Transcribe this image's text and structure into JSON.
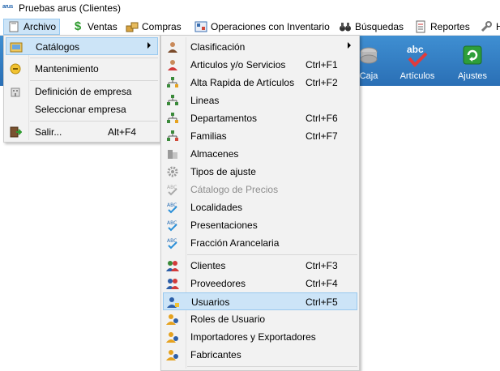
{
  "window": {
    "title": "Pruebas arus (Clientes)",
    "app_icon_text": "arus"
  },
  "menubar": {
    "items": [
      {
        "label": "Archivo",
        "icon": "file-icon"
      },
      {
        "label": "Ventas",
        "icon": "dollar-icon"
      },
      {
        "label": "Compras",
        "icon": "boxes-icon"
      },
      {
        "label": "Operaciones con Inventario",
        "icon": "inventory-icon"
      },
      {
        "label": "Búsquedas",
        "icon": "binoculars-icon"
      },
      {
        "label": "Reportes",
        "icon": "report-icon"
      },
      {
        "label": "H",
        "icon": "wrench-icon"
      }
    ]
  },
  "toolbar": {
    "caja": "Caja",
    "articulos": "Artículos",
    "articulos_badge": "abc",
    "ajustes": "Ajustes"
  },
  "archivo_menu": {
    "items": [
      {
        "label": "Catálogos",
        "shortcut": "",
        "submenu": true
      },
      {
        "label": "Mantenimiento",
        "shortcut": ""
      },
      {
        "label": "Definición de empresa",
        "shortcut": ""
      },
      {
        "label": "Seleccionar empresa",
        "shortcut": ""
      },
      {
        "label": "Salir...",
        "shortcut": "Alt+F4"
      }
    ]
  },
  "catalogos_menu": {
    "items": [
      {
        "label": "Clasificación",
        "shortcut": "",
        "submenu": true
      },
      {
        "label": "Articulos y/o Servicios",
        "shortcut": "Ctrl+F1"
      },
      {
        "label": "Alta Rapida de Artículos",
        "shortcut": "Ctrl+F2"
      },
      {
        "label": "Lineas",
        "shortcut": ""
      },
      {
        "label": "Departamentos",
        "shortcut": "Ctrl+F6"
      },
      {
        "label": "Familias",
        "shortcut": "Ctrl+F7"
      },
      {
        "label": "Almacenes",
        "shortcut": ""
      },
      {
        "label": "Tipos de ajuste",
        "shortcut": ""
      },
      {
        "label": "Cátalogo de Precios",
        "shortcut": "",
        "disabled": true
      },
      {
        "label": "Localidades",
        "shortcut": ""
      },
      {
        "label": "Presentaciones",
        "shortcut": ""
      },
      {
        "label": "Fracción Arancelaria",
        "shortcut": ""
      },
      {
        "label": "Clientes",
        "shortcut": "Ctrl+F3"
      },
      {
        "label": "Proveedores",
        "shortcut": "Ctrl+F4"
      },
      {
        "label": "Usuarios",
        "shortcut": "Ctrl+F5"
      },
      {
        "label": "Roles de Usuario",
        "shortcut": ""
      },
      {
        "label": "Importadores y Exportadores",
        "shortcut": ""
      },
      {
        "label": "Fabricantes",
        "shortcut": ""
      }
    ]
  },
  "colors": {
    "highlight": "#cce4f7",
    "highlight_border": "#99c9ef",
    "menu_bg": "#f2f2f2",
    "toolbar_blue": "#2f7cc4",
    "disabled_text": "#8d8d8d"
  }
}
